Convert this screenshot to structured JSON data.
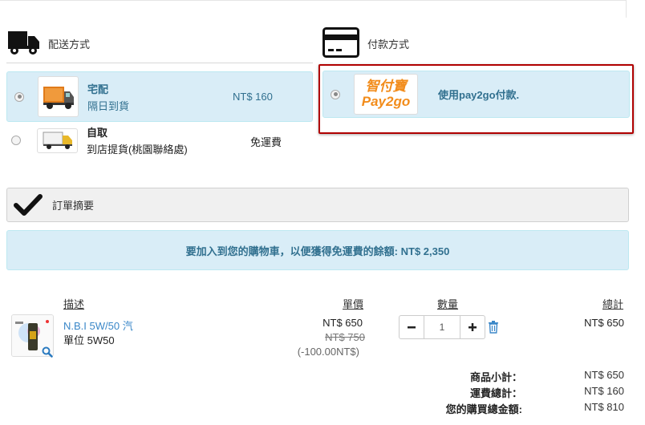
{
  "shipping": {
    "title": "配送方式",
    "options": [
      {
        "name": "宅配",
        "desc": "隔日到貨",
        "price": "NT$ 160",
        "selected": true
      },
      {
        "name": "自取",
        "desc": "到店提貨(桃園聯絡處)",
        "price": "免運費",
        "selected": false
      }
    ]
  },
  "payment": {
    "title": "付款方式",
    "logo_top": "智付寶",
    "logo_bottom": "Pay2go",
    "option_label": "使用pay2go付款.",
    "highlight_color": "#b00000"
  },
  "summary": {
    "title": "訂單摘要",
    "notice": "要加入到您的購物車，以便獲得免運費的餘額: NT$ 2,350"
  },
  "table": {
    "headers": {
      "desc": "描述",
      "unit_price": "單價",
      "qty": "數量",
      "total": "總計"
    },
    "item": {
      "name": "N.B.I 5W/50 汽",
      "unit": "單位 5W50",
      "price": "NT$ 650",
      "old_price": "NT$ 750",
      "discount": "(-100.00NT$)",
      "qty": "1",
      "total": "NT$ 650"
    }
  },
  "totals": [
    {
      "label": "商品小計：",
      "value": "NT$ 650"
    },
    {
      "label": "運費總計：",
      "value": "NT$ 160"
    },
    {
      "label": "您的購買總金額:",
      "value": "NT$ 810"
    }
  ],
  "icons": {
    "truck": "truck-icon",
    "card": "credit-card-icon",
    "check": "checkmark-icon",
    "minus": "minus-icon",
    "plus": "plus-icon",
    "trash": "trash-icon",
    "zoom": "magnifier-icon"
  }
}
